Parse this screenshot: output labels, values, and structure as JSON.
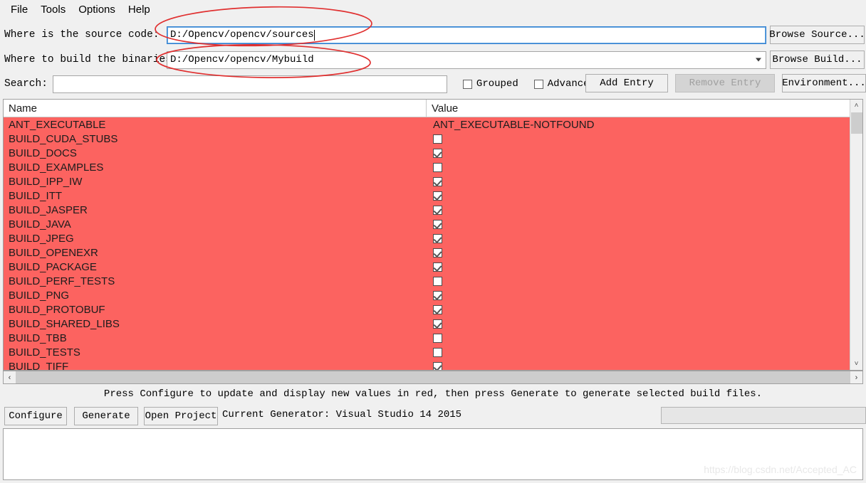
{
  "menubar": {
    "items": [
      {
        "label": "File",
        "name": "menu-file"
      },
      {
        "label": "Tools",
        "name": "menu-tools"
      },
      {
        "label": "Options",
        "name": "menu-options"
      },
      {
        "label": "Help",
        "name": "menu-help"
      }
    ]
  },
  "source_row": {
    "label": "Where is the source code:",
    "value": "D:/Opencv/opencv/sources",
    "browse_label": "Browse Source..."
  },
  "build_row": {
    "label": "Where to build the binaries:",
    "value": "D:/Opencv/opencv/Mybuild",
    "browse_label": "Browse Build..."
  },
  "search_row": {
    "label": "Search:",
    "value": "",
    "placeholder": "",
    "grouped_label": "Grouped",
    "grouped_checked": false,
    "advanced_label": "Advanced",
    "advanced_checked": false,
    "add_entry_label": "Add Entry",
    "remove_entry_label": "Remove Entry",
    "remove_entry_disabled": true,
    "environment_label": "Environment..."
  },
  "table": {
    "columns": [
      "Name",
      "Value"
    ],
    "row_background": "#fc6360",
    "rows": [
      {
        "name": "ANT_EXECUTABLE",
        "type": "text",
        "value": "ANT_EXECUTABLE-NOTFOUND"
      },
      {
        "name": "BUILD_CUDA_STUBS",
        "type": "checkbox",
        "checked": false
      },
      {
        "name": "BUILD_DOCS",
        "type": "checkbox",
        "checked": true
      },
      {
        "name": "BUILD_EXAMPLES",
        "type": "checkbox",
        "checked": false
      },
      {
        "name": "BUILD_IPP_IW",
        "type": "checkbox",
        "checked": true
      },
      {
        "name": "BUILD_ITT",
        "type": "checkbox",
        "checked": true
      },
      {
        "name": "BUILD_JASPER",
        "type": "checkbox",
        "checked": true
      },
      {
        "name": "BUILD_JAVA",
        "type": "checkbox",
        "checked": true
      },
      {
        "name": "BUILD_JPEG",
        "type": "checkbox",
        "checked": true
      },
      {
        "name": "BUILD_OPENEXR",
        "type": "checkbox",
        "checked": true
      },
      {
        "name": "BUILD_PACKAGE",
        "type": "checkbox",
        "checked": true
      },
      {
        "name": "BUILD_PERF_TESTS",
        "type": "checkbox",
        "checked": false
      },
      {
        "name": "BUILD_PNG",
        "type": "checkbox",
        "checked": true
      },
      {
        "name": "BUILD_PROTOBUF",
        "type": "checkbox",
        "checked": true
      },
      {
        "name": "BUILD_SHARED_LIBS",
        "type": "checkbox",
        "checked": true
      },
      {
        "name": "BUILD_TBB",
        "type": "checkbox",
        "checked": false
      },
      {
        "name": "BUILD_TESTS",
        "type": "checkbox",
        "checked": false
      },
      {
        "name": "BUILD_TIFF",
        "type": "checkbox",
        "checked": true
      }
    ]
  },
  "scrollbars": {
    "up_arrow": "˄",
    "down_arrow": "˅",
    "left_arrow": "‹",
    "right_arrow": "›"
  },
  "status": {
    "message": "Press Configure to update and display new values in red, then press Generate to generate selected build files."
  },
  "bottom": {
    "configure_label": "Configure",
    "generate_label": "Generate",
    "open_project_label": "Open Project",
    "generator_text": "Current Generator: Visual Studio 14 2015"
  },
  "watermark": {
    "text": "https://blog.csdn.net/Accepted_AC"
  },
  "annotations": {
    "accent_color": "#e03030"
  }
}
